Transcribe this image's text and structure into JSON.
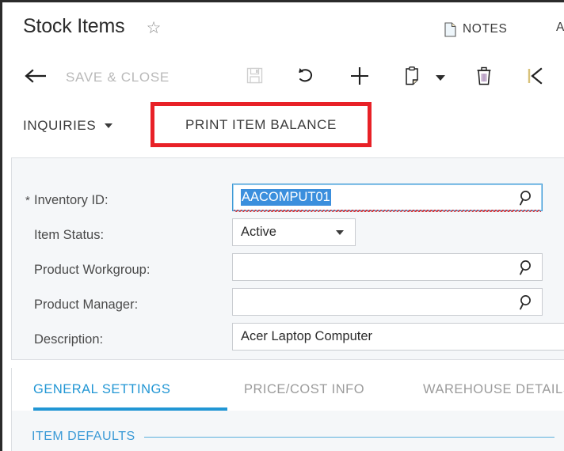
{
  "window": {
    "title": "Stock Items"
  },
  "header": {
    "title": "Stock Items",
    "favorite_icon": "star-outline-icon",
    "notes": {
      "label": "NOTES",
      "icon": "note-document-icon"
    },
    "activities": {
      "label": "ACTIVITIES"
    }
  },
  "toolbar": {
    "back": {
      "label": "",
      "icon": "back-arrow-icon"
    },
    "save_close": {
      "label": "SAVE & CLOSE",
      "enabled": false
    },
    "save": {
      "icon": "floppy-save-icon",
      "enabled": false
    },
    "undo": {
      "icon": "undo-arrow-icon"
    },
    "add": {
      "icon": "plus-icon"
    },
    "copy": {
      "icon": "clipboard-icon"
    },
    "copy_caret": {
      "icon": "chevron-down-icon"
    },
    "delete": {
      "icon": "trash-icon"
    },
    "first": {
      "icon": "first-record-icon"
    }
  },
  "action_row": {
    "inquiries": {
      "label": "INQUIRIES",
      "icon": "chevron-down-icon"
    },
    "print_item_balance": {
      "label": "PRINT ITEM BALANCE"
    },
    "highlight_color": "#e82127"
  },
  "form": {
    "fields": [
      {
        "label": "Inventory ID:",
        "required": true,
        "value": "AACOMPUT01",
        "type": "lookup",
        "selected": true,
        "focused": true,
        "spellcheck_error": true,
        "icon": "search-icon"
      },
      {
        "label": "Item Status:",
        "required": false,
        "value": "Active",
        "type": "dropdown",
        "icon": "chevron-down-icon"
      },
      {
        "label": "Product Workgroup:",
        "required": false,
        "value": "",
        "type": "lookup",
        "icon": "search-icon"
      },
      {
        "label": "Product Manager:",
        "required": false,
        "value": "",
        "type": "lookup",
        "icon": "search-icon"
      },
      {
        "label": "Description:",
        "required": false,
        "value": "Acer Laptop Computer",
        "type": "text"
      }
    ]
  },
  "tabs": {
    "active_index": 0,
    "items": [
      {
        "label": "GENERAL SETTINGS"
      },
      {
        "label": "PRICE/COST INFO"
      },
      {
        "label": "WAREHOUSE DETAILS"
      }
    ]
  },
  "section": {
    "item_defaults": {
      "label": "ITEM DEFAULTS"
    }
  },
  "colors": {
    "accent": "#2196d4",
    "highlight": "#e82127",
    "selection": "#3b8fdd",
    "panel_bg": "#f5f7f9"
  }
}
